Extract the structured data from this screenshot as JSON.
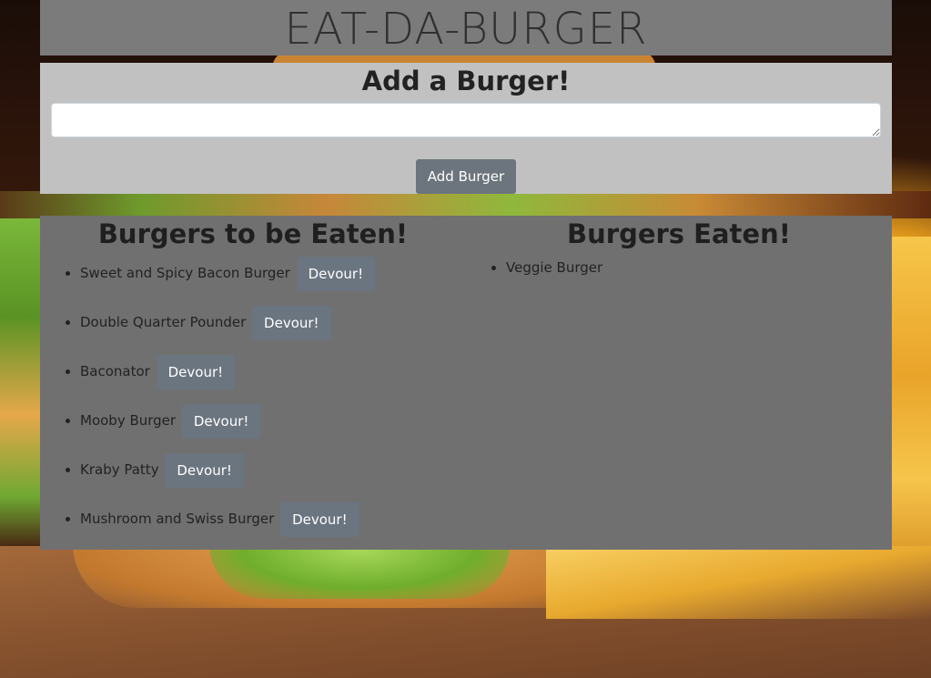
{
  "header": {
    "title": "EAT-DA-BURGER"
  },
  "add_form": {
    "heading": "Add a Burger!",
    "input_value": "",
    "button_label": "Add Burger"
  },
  "to_be_eaten": {
    "heading": "Burgers to be Eaten!",
    "devour_label": "Devour!",
    "items": [
      "Sweet and Spicy Bacon Burger",
      "Double Quarter Pounder",
      "Baconator",
      "Mooby Burger",
      "Kraby Patty",
      "Mushroom and Swiss Burger"
    ]
  },
  "eaten": {
    "heading": "Burgers Eaten!",
    "items": [
      "Veggie Burger"
    ]
  },
  "colors": {
    "header_bg": "#7b7b7b",
    "form_bg": "#c1c1c1",
    "lists_bg": "#707070",
    "button_bg": "#6c757d"
  }
}
